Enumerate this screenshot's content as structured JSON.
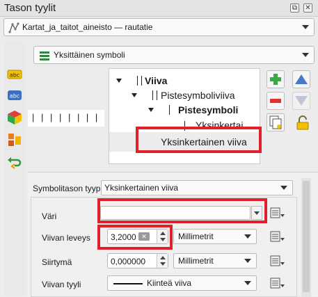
{
  "window": {
    "title": "Tason tyylit",
    "buttons": [
      "⧉",
      "✕"
    ]
  },
  "layer_combo": {
    "value": "Kartat_ja_taitot_aineisto — rautatie"
  },
  "renderer_combo": {
    "value": "Yksittäinen symboli"
  },
  "tree": {
    "rows": [
      {
        "label": "Viiva",
        "bold": true
      },
      {
        "label": "Pistesymboliviiva",
        "bold": false
      },
      {
        "label": "Pistesymboli",
        "bold": true
      },
      {
        "label": "Yksinkertai",
        "bold": false
      },
      {
        "label": "Yksinkertainen viiva",
        "bold": false
      }
    ]
  },
  "dash_preview": "| | | | | | | |",
  "symbol_layer_type": {
    "label": "Symbolitason tyyppi",
    "value": "Yksinkertainen viiva"
  },
  "props": {
    "color_label": "Väri",
    "width_label": "Viivan leveys",
    "width_value": "3,2000",
    "width_unit": "Millimetrit",
    "offset_label": "Siirtymä",
    "offset_value": "0,000000",
    "offset_unit": "Millimetrit",
    "style_label": "Viivan tyyli",
    "style_value": "Kiinteä viiva"
  },
  "colors": {
    "highlight": "#e0202a",
    "selected_row": "#ececec"
  },
  "icons": {
    "sidebar": [
      "brush-icon",
      "label-abc-icon",
      "label-abc-blue-icon",
      "3d-cube-icon",
      "diagram-icon",
      "history-icon"
    ],
    "tree_buttons": [
      "add-symbol-layer-icon",
      "remove-symbol-layer-icon",
      "duplicate-layer-icon",
      "move-up-icon",
      "move-down-icon",
      "lock-icon"
    ]
  }
}
